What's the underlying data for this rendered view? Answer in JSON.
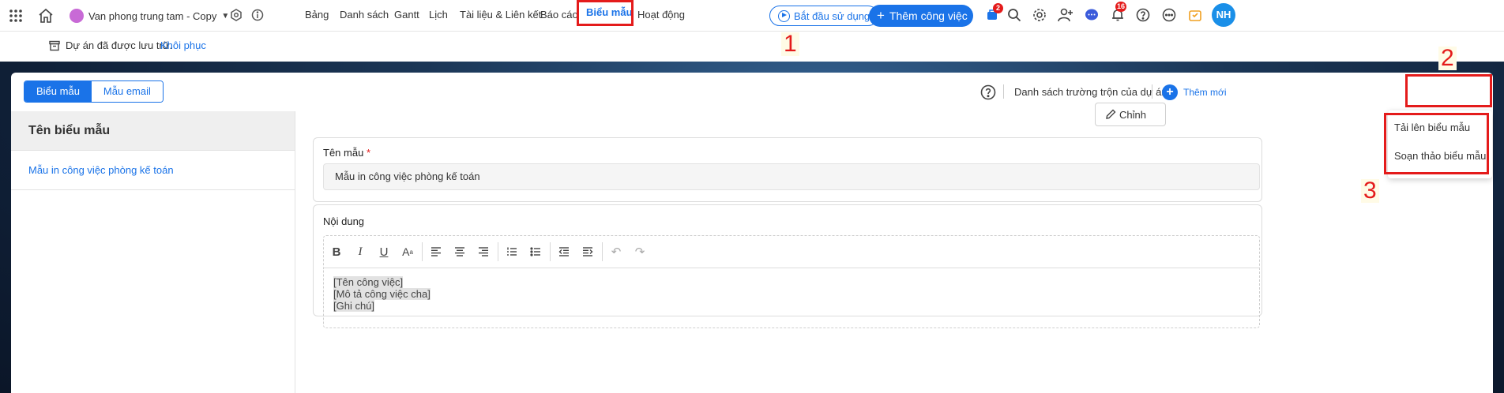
{
  "topbar": {
    "project_name": "Van phong trung tam - Copy",
    "nav_tabs": [
      "Bảng",
      "Danh sách",
      "Gantt",
      "Lịch",
      "Tài liệu & Liên kết",
      "Báo cáo",
      "Biểu mẫu",
      "Hoạt động"
    ],
    "active_tab": "Biểu mẫu",
    "start_button": "Bắt đầu sử dụng",
    "add_task_button": "Thêm công việc",
    "cart_badge": "2",
    "notification_badge": "16",
    "avatar_initials": "NH",
    "accent_color": "#1a73e8"
  },
  "archive_bar": {
    "message": "Dự án đã được lưu trữ.",
    "restore_link": "Khôi phục"
  },
  "segmented": {
    "form_tab": "Biểu mẫu",
    "email_tab": "Mẫu email"
  },
  "header_right": {
    "merge_fields_link": "Danh sách trường trộn của dự án",
    "add_new_button": "Thêm mới"
  },
  "dropdown": {
    "upload_item": "Tải lên biểu mẫu",
    "compose_item": "Soạn thảo biểu mẫu"
  },
  "left_panel": {
    "heading": "Tên biểu mẫu",
    "items": [
      "Mẫu in công việc phòng kế toán"
    ]
  },
  "detail": {
    "edit_button": "Chỉnh",
    "name_label": "Tên mẫu",
    "required_mark": "*",
    "name_value": "Mẫu in công việc phòng kế toán",
    "content_label": "Nội dung",
    "content_lines": [
      "[Tên công việc]",
      "[Mô tả công việc cha]",
      "[Ghi chú]"
    ]
  },
  "annotations": {
    "step1": "1",
    "step2": "2",
    "step3": "3"
  }
}
